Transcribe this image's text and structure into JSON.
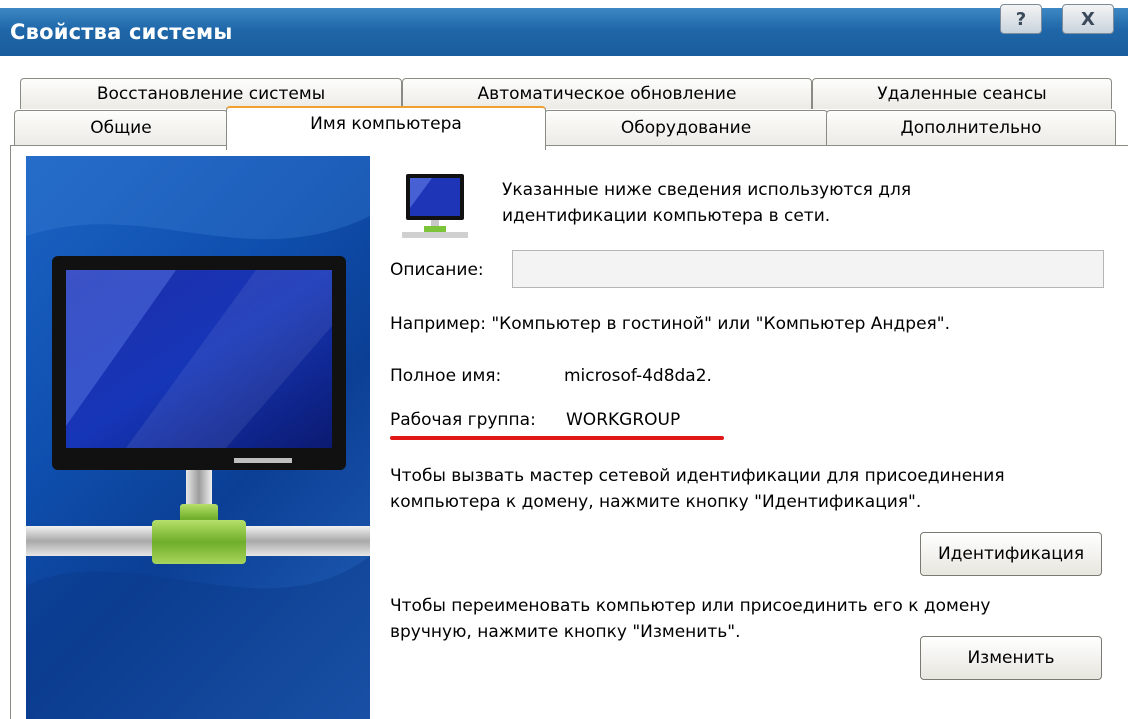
{
  "window": {
    "title": "Свойства системы",
    "help_label": "?",
    "close_label": "X"
  },
  "tabs": {
    "row1": [
      {
        "label": "Восстановление системы"
      },
      {
        "label": "Автоматическое обновление"
      },
      {
        "label": "Удаленные сеансы"
      }
    ],
    "row2": [
      {
        "label": "Общие"
      },
      {
        "label": "Имя компьютера",
        "active": true
      },
      {
        "label": "Оборудование"
      },
      {
        "label": "Дополнительно"
      }
    ]
  },
  "content": {
    "info_line1": "Указанные ниже сведения используются для",
    "info_line2": "идентификации компьютера в сети.",
    "description_label": "Описание:",
    "description_value": "",
    "example": "Например: \"Компьютер в гостиной\" или \"Компьютер Андрея\".",
    "fullname_label": "Полное имя:",
    "fullname_value": "microsof-4d8da2.",
    "workgroup_label": "Рабочая группа:",
    "workgroup_value": "WORKGROUP",
    "wizard_line1": "Чтобы вызвать мастер сетевой идентификации для присоединения",
    "wizard_line2": "компьютера к домену, нажмите кнопку \"Идентификация\".",
    "identify_button": "Идентификация",
    "rename_line1": "Чтобы переименовать компьютер или присоединить его к домену",
    "rename_line2": "вручную, нажмите кнопку \"Изменить\".",
    "change_button": "Изменить"
  },
  "colors": {
    "titlebar": "#1f67a9",
    "underline": "#e01818",
    "active_tab_accent": "#f0a030"
  },
  "icons": {
    "big_art": "network-computer-icon",
    "small": "computer-icon"
  }
}
